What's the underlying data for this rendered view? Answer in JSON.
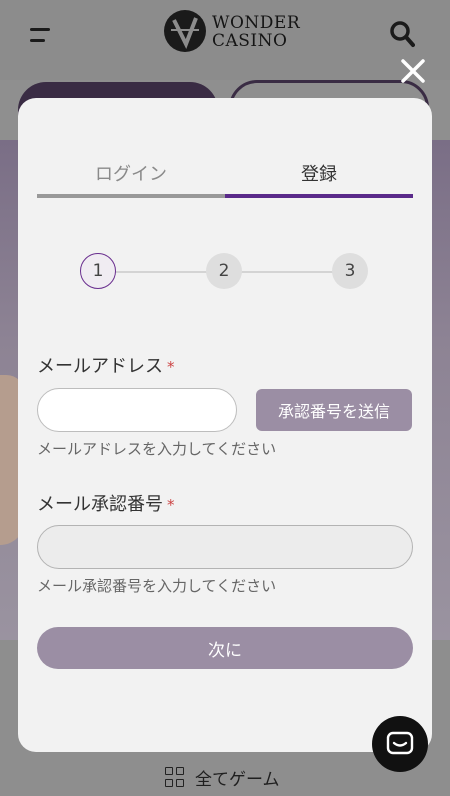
{
  "header": {
    "logo_line1": "WONDER",
    "logo_line2": "CASINO"
  },
  "modal": {
    "tabs": [
      {
        "label": "ログイン"
      },
      {
        "label": "登録"
      }
    ],
    "steps": [
      "1",
      "2",
      "3"
    ],
    "email": {
      "label": "メールアドレス",
      "required_mark": "*",
      "value": "",
      "send_button": "承認番号を送信",
      "hint": "メールアドレスを入力してください"
    },
    "code": {
      "label": "メール承認番号",
      "required_mark": "*",
      "value": "",
      "hint": "メール承認番号を入力してください"
    },
    "next_button": "次に"
  },
  "footer": {
    "all_games": "全てゲーム"
  },
  "colors": {
    "accent": "#5a2a8a",
    "button": "#9b8ea4",
    "overlay": "#8f8f8f"
  }
}
